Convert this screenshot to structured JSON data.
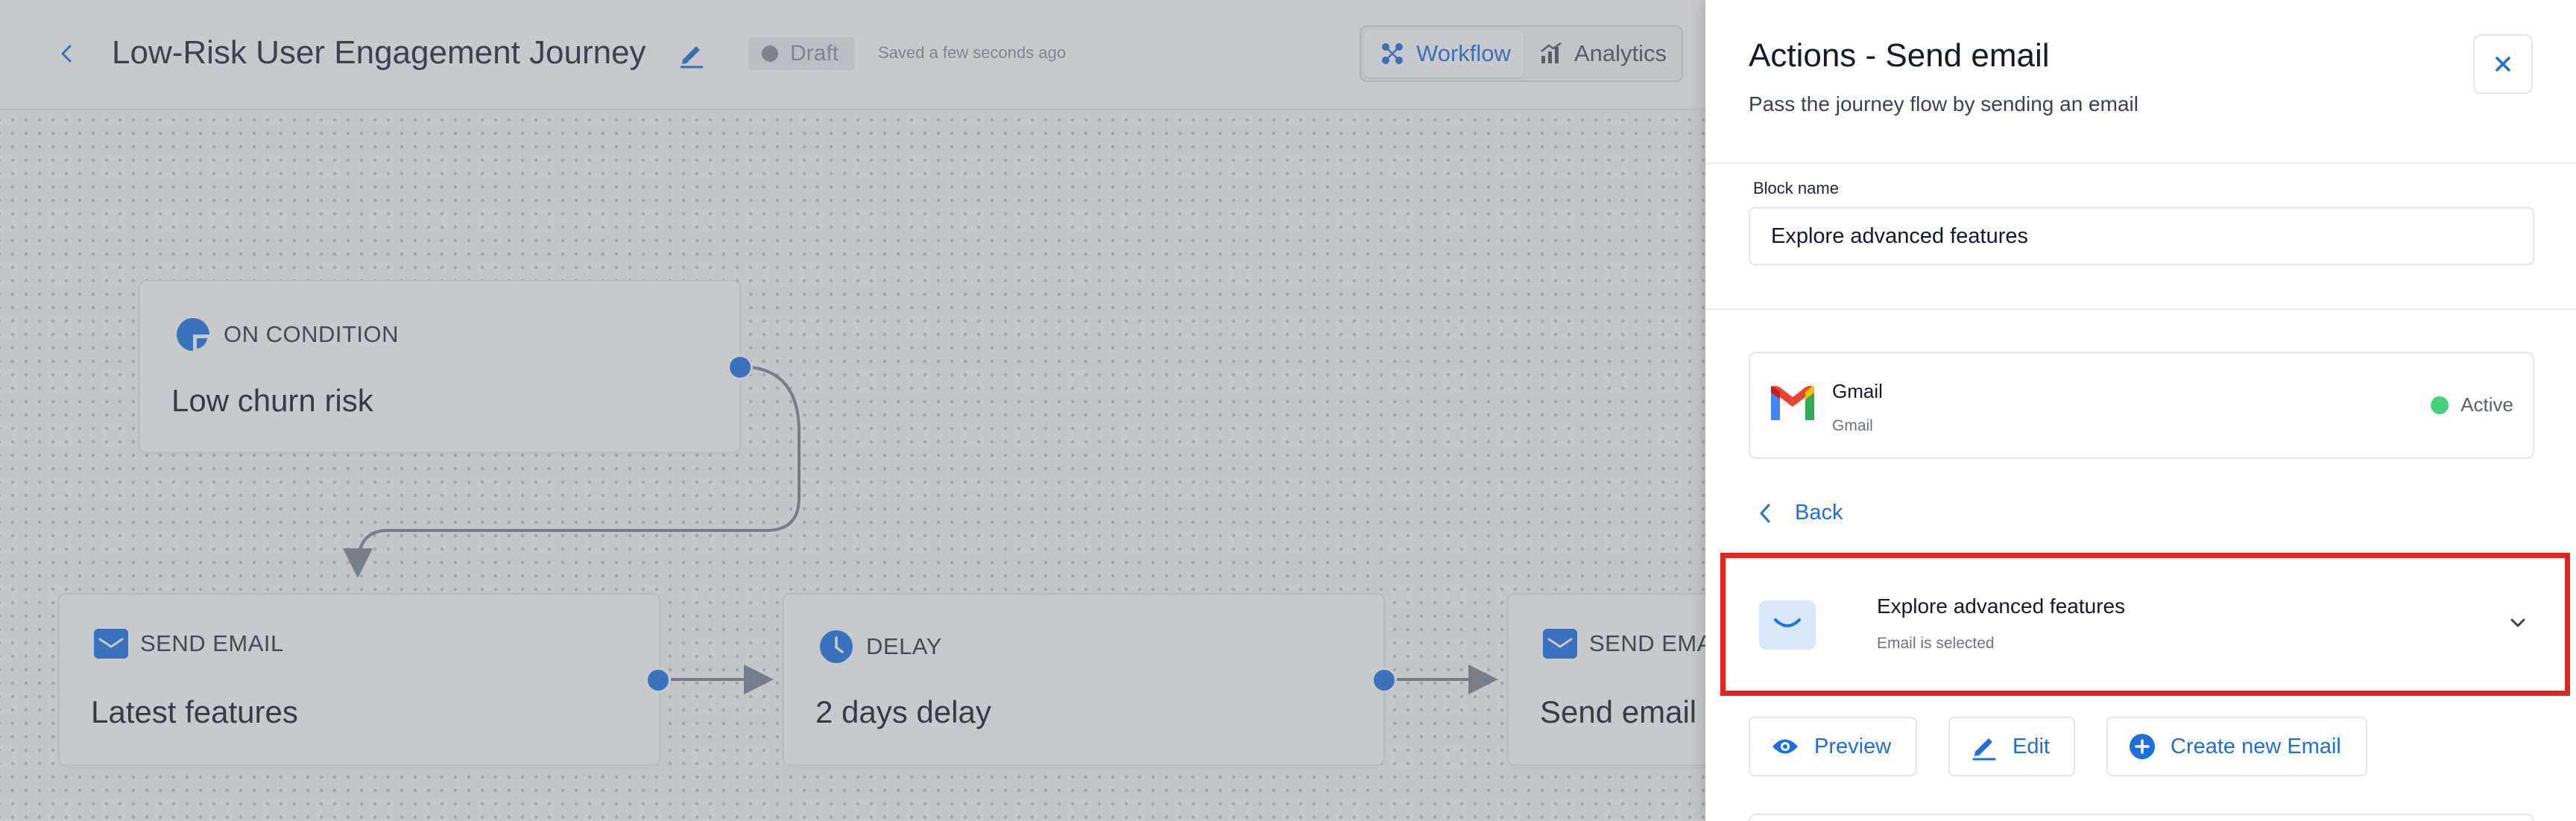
{
  "header": {
    "journey_title": "Low-Risk User Engagement Journey",
    "status": "Draft",
    "saved_text": "Saved a few seconds ago",
    "tabs": [
      {
        "label": "Workflow",
        "icon": "workflow-icon",
        "active": true
      },
      {
        "label": "Analytics",
        "icon": "analytics-icon",
        "active": false
      }
    ]
  },
  "nodes": {
    "condition": {
      "kind": "ON CONDITION",
      "title": "Low churn risk",
      "icon": "condition-pie-icon"
    },
    "send_email_1": {
      "kind": "SEND EMAIL",
      "title": "Latest features",
      "icon": "envelope-icon"
    },
    "delay": {
      "kind": "DELAY",
      "title": "2 days delay",
      "icon": "clock-icon"
    },
    "send_email_2": {
      "kind": "SEND EMAIL",
      "title": "Send email",
      "icon": "envelope-icon"
    }
  },
  "panel": {
    "title": "Actions - Send email",
    "subtitle": "Pass the journey flow by sending an email",
    "block_name_label": "Block name",
    "block_name_value": "Explore advanced features",
    "provider": {
      "name": "Gmail",
      "sub": "Gmail",
      "status": "Active"
    },
    "back_label": "Back",
    "selected_email": {
      "title": "Explore advanced features",
      "sub": "Email is selected"
    },
    "buttons": {
      "preview": "Preview",
      "edit": "Edit",
      "create": "Create new Email"
    }
  },
  "colors": {
    "accent": "#1f6fd8",
    "node_icon": "#1a73e8",
    "active_status": "#44d37a",
    "highlight": "#e3261b"
  }
}
